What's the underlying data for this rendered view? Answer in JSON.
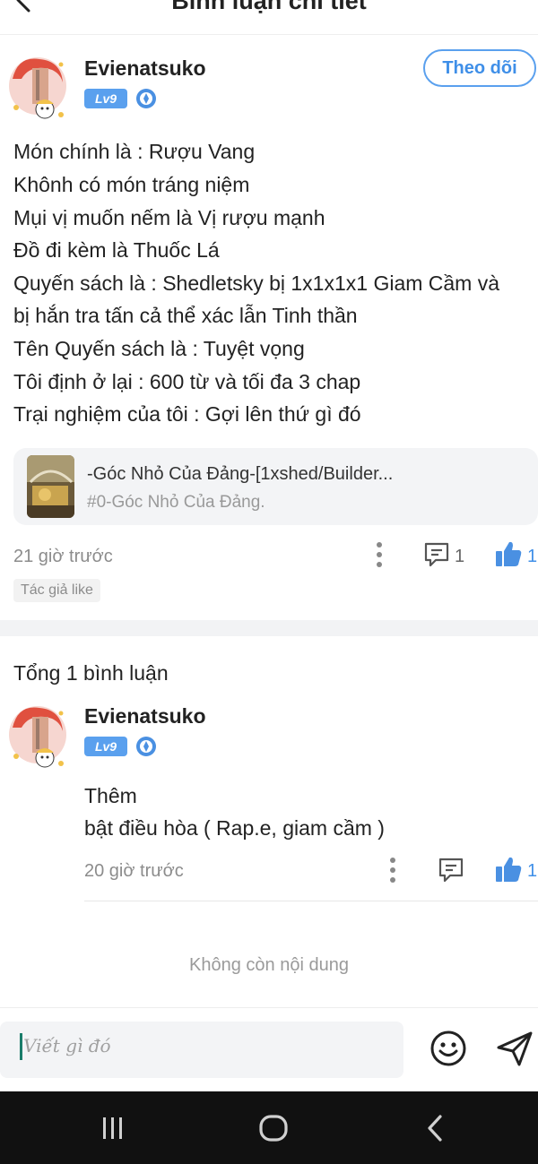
{
  "header": {
    "title": "Bình luận chi tiết"
  },
  "post": {
    "author": {
      "name": "Evienatsuko",
      "level": "Lv9"
    },
    "follow_label": "Theo dõi",
    "lines": [
      "Món chính là : Rượu Vang",
      "Khônh có món tráng niệm",
      "Mụi vị muốn nếm là Vị rượu mạnh",
      "Đồ đi kèm là Thuốc Lá",
      "Quyến sách là : Shedletsky bị 1x1x1x1 Giam Cầm và",
      "bị hắn tra tấn cả thể xác lẫn Tinh thần",
      "Tên Quyến sách là : Tuyệt vọng",
      "Tôi định ở lại : 600 từ và tối đa 3 chap",
      "Trại nghiệm của tôi : Gợi lên thứ gì đó"
    ],
    "story": {
      "title": "-Góc Nhỏ Của Đảng-[1xshed/Builder...",
      "subtitle": "#0-Góc Nhỏ Của Đảng."
    },
    "time": "21 giờ trước",
    "comment_count": "1",
    "like_count": "1",
    "author_like_tag": "Tác giả like"
  },
  "comments_section": {
    "total_label": "Tổng 1 bình luận",
    "comments": [
      {
        "author": {
          "name": "Evienatsuko",
          "level": "Lv9"
        },
        "lines": [
          "Thêm",
          "bật điều hòa ( Rap.e, giam cầm )"
        ],
        "time": "20 giờ trước",
        "like_count": "1"
      }
    ],
    "end_label": "Không còn nội dung"
  },
  "input": {
    "placeholder": "Viết gì đó"
  },
  "colors": {
    "accent": "#3f8fe8",
    "badge": "#5aa0ee",
    "icon": "#4a90e2"
  },
  "icons": [
    "back-icon",
    "more-icon",
    "comment-icon",
    "thumbs-up-icon",
    "emoji-icon",
    "send-icon",
    "recent-apps-icon",
    "home-icon",
    "back-nav-icon"
  ]
}
